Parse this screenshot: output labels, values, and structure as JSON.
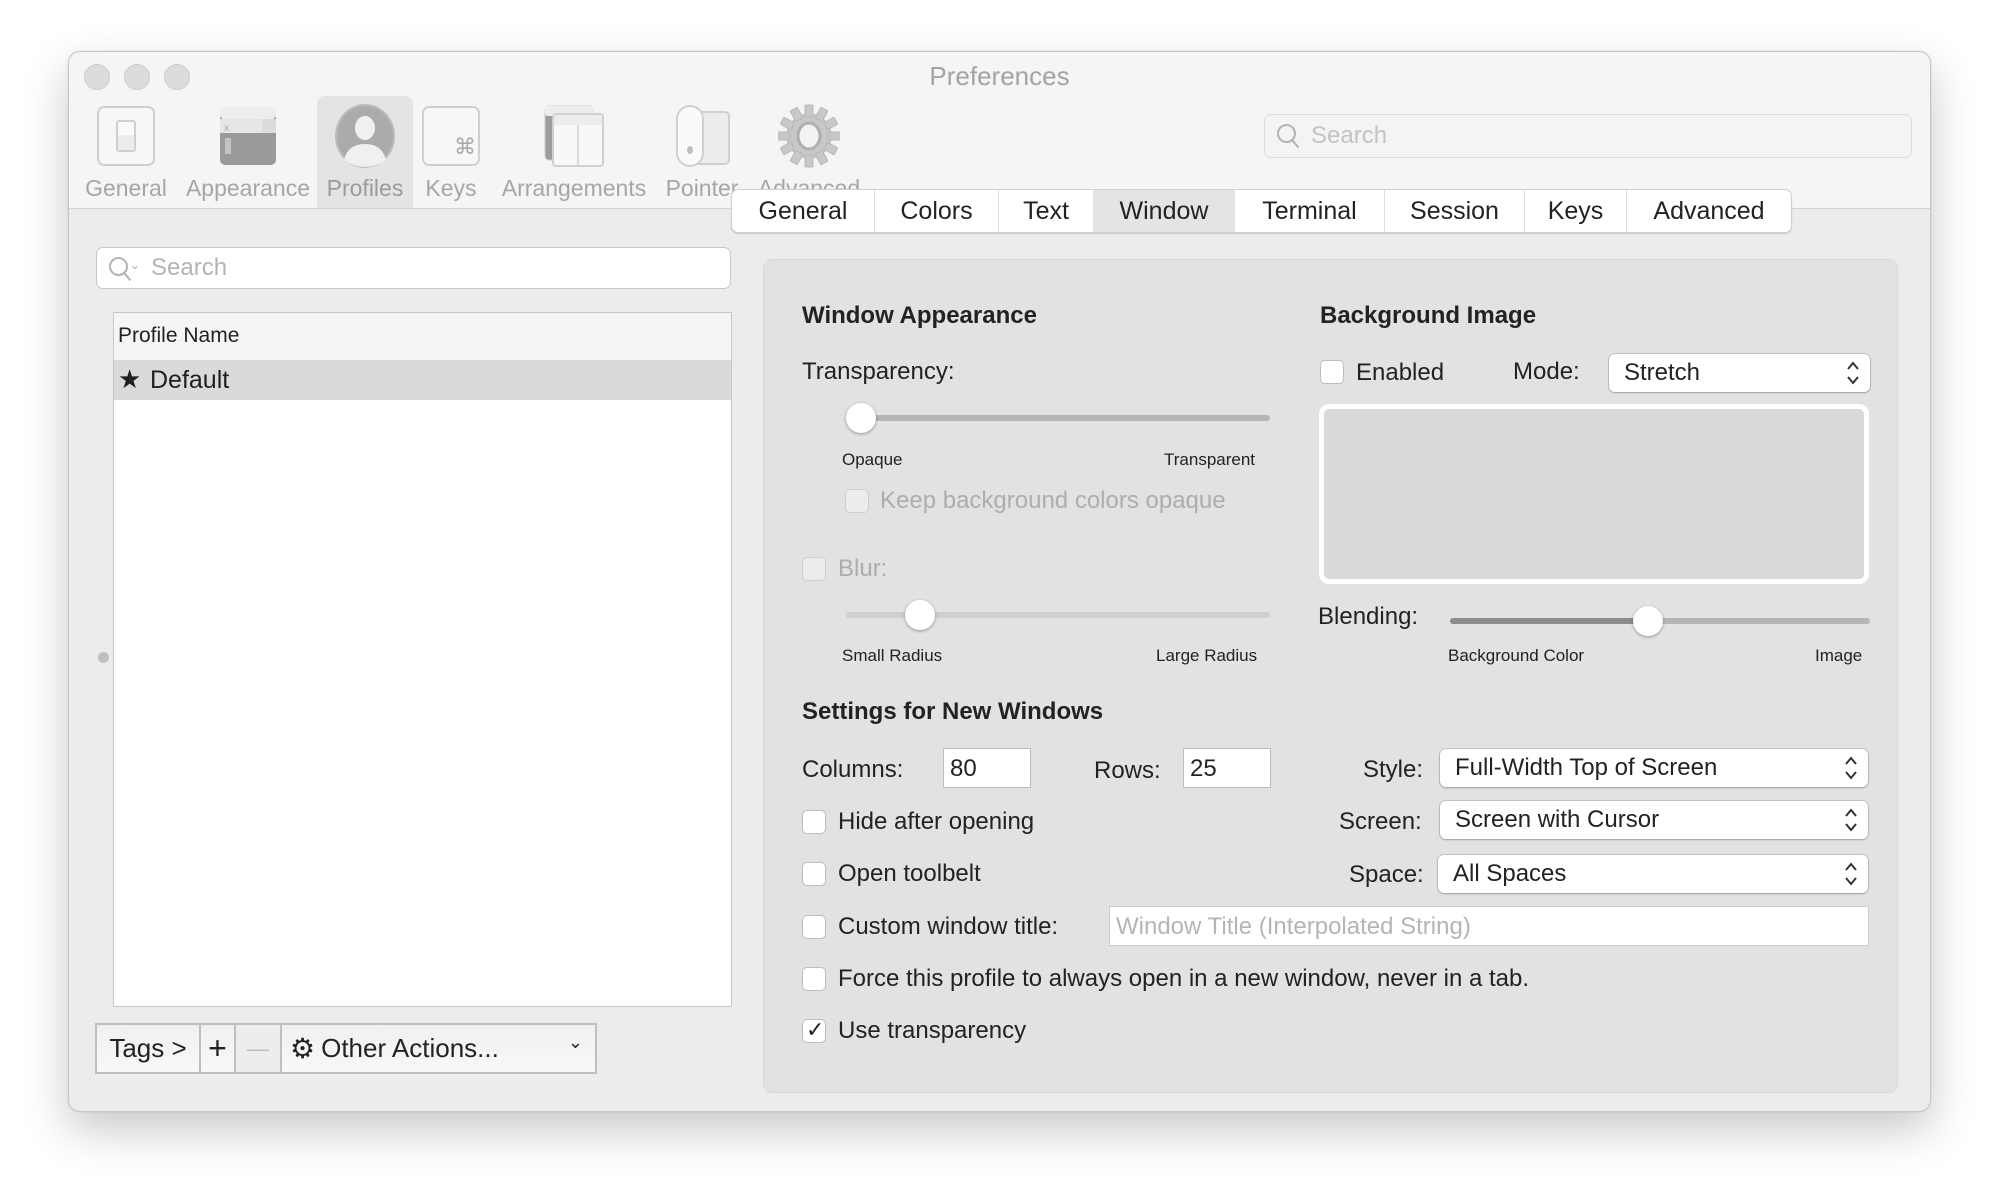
{
  "window": {
    "title": "Preferences",
    "traffic_lights": [
      "close",
      "minimize",
      "zoom"
    ]
  },
  "toolbar": {
    "items": [
      {
        "label": "General",
        "icon": "general-switch-icon",
        "selected": false
      },
      {
        "label": "Appearance",
        "icon": "appearance-window-icon",
        "selected": false
      },
      {
        "label": "Profiles",
        "icon": "profile-person-icon",
        "selected": true
      },
      {
        "label": "Keys",
        "icon": "command-key-icon",
        "selected": false
      },
      {
        "label": "Arrangements",
        "icon": "arrangements-windows-icon",
        "selected": false
      },
      {
        "label": "Pointer",
        "icon": "mouse-pointer-icon",
        "selected": false
      },
      {
        "label": "Advanced",
        "icon": "gear-icon",
        "selected": false
      }
    ],
    "search_placeholder": "Search"
  },
  "profiles_pane": {
    "search_placeholder": "Search",
    "table": {
      "column_header": "Profile Name",
      "rows": [
        {
          "name": "Default",
          "is_default": true,
          "selected": true
        }
      ]
    },
    "buttons": {
      "tags": "Tags >",
      "add": "+",
      "remove": "—",
      "other_actions": "Other Actions..."
    }
  },
  "tabs": {
    "items": [
      "General",
      "Colors",
      "Text",
      "Window",
      "Terminal",
      "Session",
      "Keys",
      "Advanced"
    ],
    "active": "Window"
  },
  "window_appearance": {
    "title": "Window Appearance",
    "transparency_label": "Transparency:",
    "transparency_value_pct": 0,
    "transparency_min_label": "Opaque",
    "transparency_max_label": "Transparent",
    "keep_bg_opaque_label": "Keep background colors opaque",
    "keep_bg_opaque_checked": false,
    "keep_bg_opaque_enabled": false,
    "blur_label": "Blur:",
    "blur_checked": false,
    "blur_enabled": false,
    "blur_value_pct": 15,
    "blur_min_label": "Small Radius",
    "blur_max_label": "Large Radius"
  },
  "background_image": {
    "title": "Background Image",
    "enabled_label": "Enabled",
    "enabled_checked": false,
    "mode_label": "Mode:",
    "mode_value": "Stretch",
    "blending_label": "Blending:",
    "blending_value_pct": 47,
    "blending_min_label": "Background Color",
    "blending_max_label": "Image"
  },
  "new_windows": {
    "title": "Settings for New Windows",
    "columns_label": "Columns:",
    "columns_value": "80",
    "rows_label": "Rows:",
    "rows_value": "25",
    "style_label": "Style:",
    "style_value": "Full-Width Top of Screen",
    "screen_label": "Screen:",
    "screen_value": "Screen with Cursor",
    "space_label": "Space:",
    "space_value": "All Spaces",
    "hide_after_opening_label": "Hide after opening",
    "hide_after_opening_checked": false,
    "open_toolbelt_label": "Open toolbelt",
    "open_toolbelt_checked": false,
    "custom_title_label": "Custom window title:",
    "custom_title_checked": false,
    "custom_title_placeholder": "Window Title (Interpolated String)",
    "force_new_window_label": "Force this profile to always open in a new window, never in a tab.",
    "force_new_window_checked": false,
    "use_transparency_label": "Use transparency",
    "use_transparency_checked": true
  }
}
